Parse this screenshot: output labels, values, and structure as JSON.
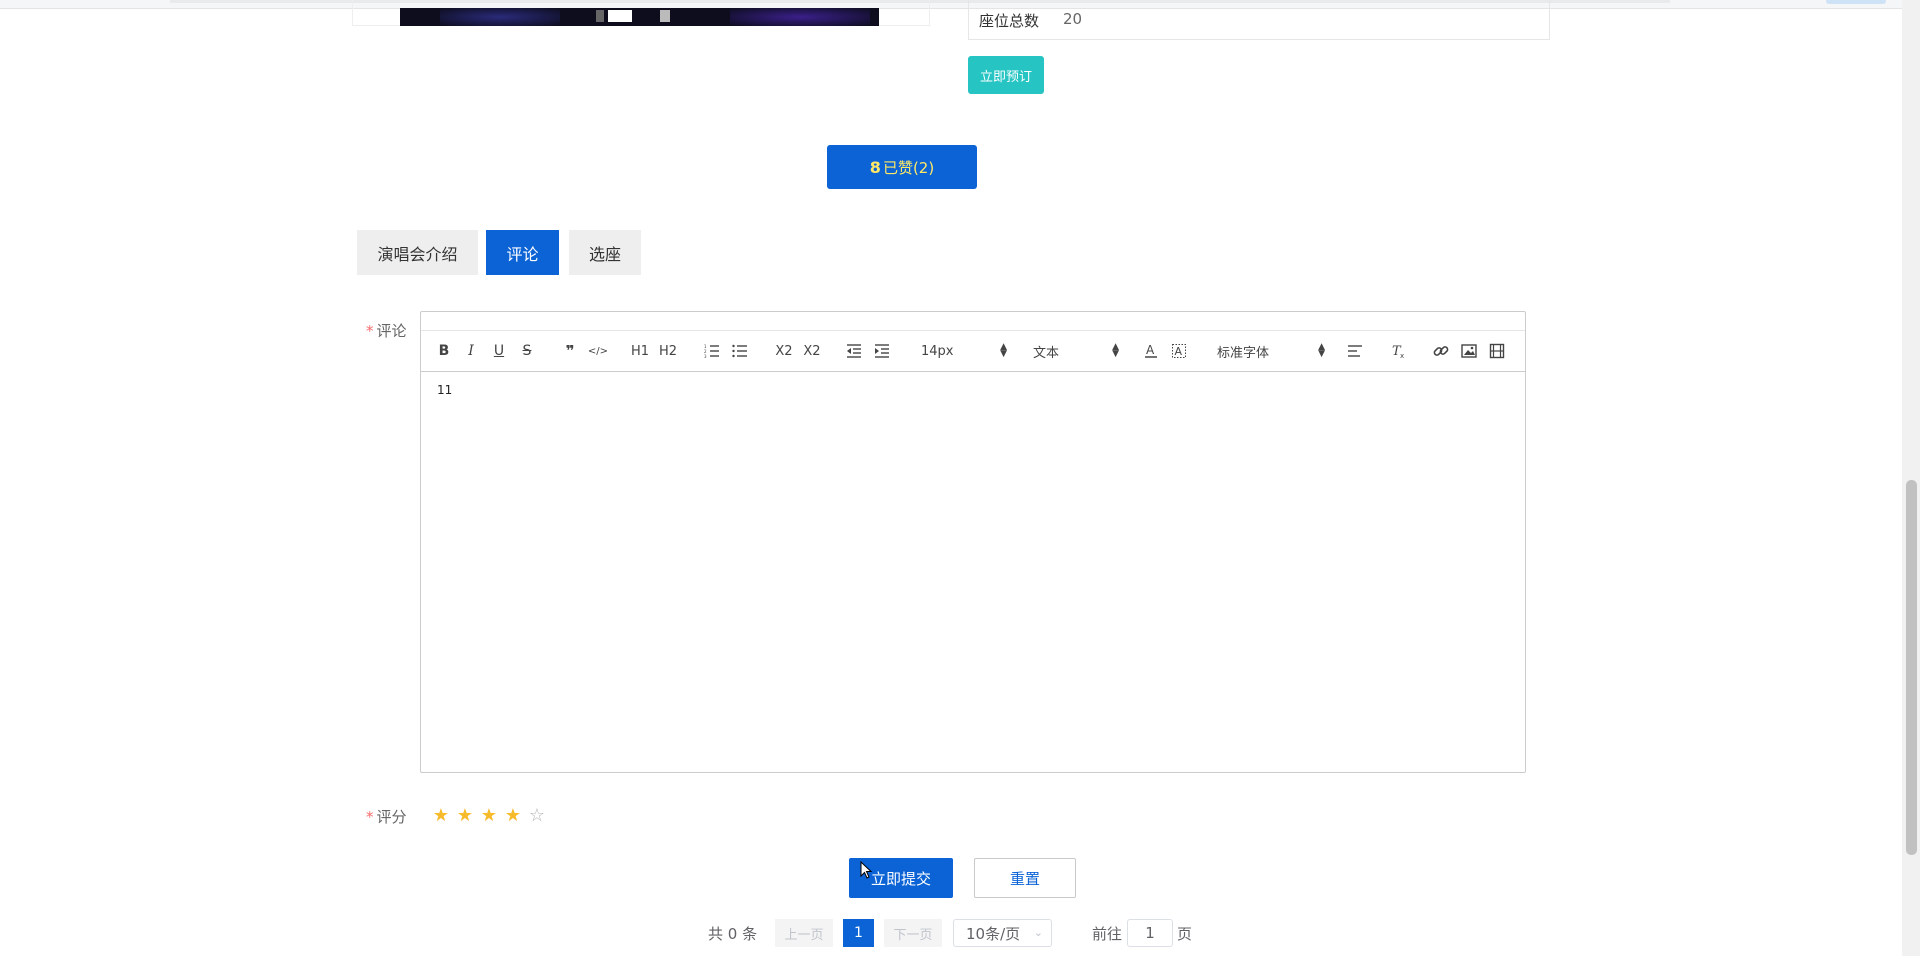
{
  "details": {
    "seat_total_label": "座位总数",
    "seat_total_value": "20",
    "book_button": "立即预订"
  },
  "like": {
    "label": "已赞(2)",
    "icon": "thumb-up-icon"
  },
  "tabs": [
    {
      "label": "演唱会介绍",
      "active": false
    },
    {
      "label": "评论",
      "active": true
    },
    {
      "label": "选座",
      "active": false
    }
  ],
  "form": {
    "required_mark": "*",
    "comment_label": "评论",
    "rating_label": "评分",
    "rating_value": 4,
    "rating_max": 5,
    "editor": {
      "toolbar": {
        "bold": "B",
        "italic": "I",
        "underline": "U",
        "strike": "S",
        "blockquote": "❞",
        "code": "</>",
        "h1": "H1",
        "h2": "H2",
        "sub": "X2",
        "sup": "X2",
        "size_picker": "14px",
        "header_picker": "文本",
        "font_picker": "标准字体"
      },
      "content": "11"
    },
    "submit_button": "立即提交",
    "reset_button": "重置"
  },
  "pagination": {
    "total": "共 0 条",
    "prev": "上一页",
    "current": "1",
    "next": "下一页",
    "page_size": "10条/页",
    "goto_prefix": "前往",
    "goto_value": "1",
    "goto_suffix": "页"
  },
  "colors": {
    "primary": "#0b63d6",
    "book_button": "#27c4c4",
    "like_text": "#ffe866",
    "star": "#f7ba2a",
    "required": "#f56c6c"
  }
}
